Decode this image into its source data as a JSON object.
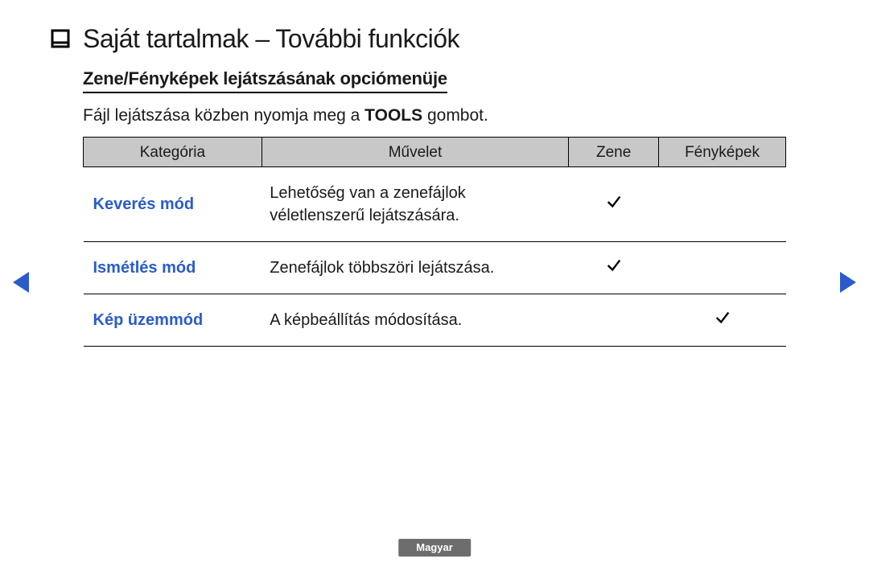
{
  "title": "Saját tartalmak – További funkciók",
  "subheading": "Zene/Fényképek lejátszásának opciómenüje",
  "intro_before": "Fájl lejátszása közben nyomja meg a ",
  "intro_bold": "TOOLS",
  "intro_after": " gombot.",
  "headers": {
    "category": "Kategória",
    "operation": "Művelet",
    "music": "Zene",
    "photos": "Fényképek"
  },
  "rows": [
    {
      "category": "Keverés mód",
      "operation": "Lehetőség van a zenefájlok véletlenszerű lejátszására.",
      "music": true,
      "photos": false
    },
    {
      "category": "Ismétlés mód",
      "operation": "Zenefájlok többszöri lejátszása.",
      "music": true,
      "photos": false
    },
    {
      "category": "Kép üzemmód",
      "operation": "A képbeállítás módosítása.",
      "music": false,
      "photos": true
    }
  ],
  "language_badge": "Magyar",
  "icons": {
    "bullet": "square-outline-icon",
    "check": "check-icon",
    "arrow_left": "arrow-left-icon",
    "arrow_right": "arrow-right-icon"
  }
}
